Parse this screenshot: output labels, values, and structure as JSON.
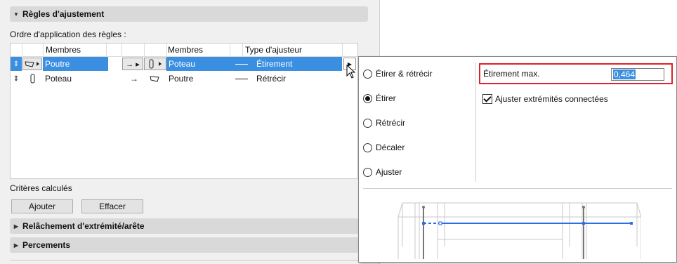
{
  "sections": {
    "rules_title": "Règles d'ajustement",
    "release_title": "Relâchement d'extrémité/arête",
    "holes_title": "Percements"
  },
  "rules": {
    "order_label": "Ordre d'application des règles :",
    "columns": {
      "members1": "Membres",
      "members2": "Membres",
      "type": "Type d'ajusteur"
    },
    "rows": [
      {
        "from": "Poutre",
        "to": "Poteau",
        "type": "Étirement",
        "selected": true
      },
      {
        "from": "Poteau",
        "to": "Poutre",
        "type": "Rétrécir",
        "selected": false
      }
    ]
  },
  "criteria": {
    "label": "Critères calculés",
    "add_button": "Ajouter",
    "delete_button": "Effacer"
  },
  "popup": {
    "options": [
      "Étirer & rétrécir",
      "Étirer",
      "Rétrécir",
      "Décaler",
      "Ajuster"
    ],
    "selected_option": "Étirer",
    "max_label": "Étirement max.",
    "max_value": "0,464",
    "checkbox_label": "Ajuster extrémités connectées",
    "checkbox_checked": true
  },
  "colors": {
    "selection": "#3b8fe0",
    "highlight_box": "#e0202a",
    "preview_line": "#2b6fe0"
  }
}
